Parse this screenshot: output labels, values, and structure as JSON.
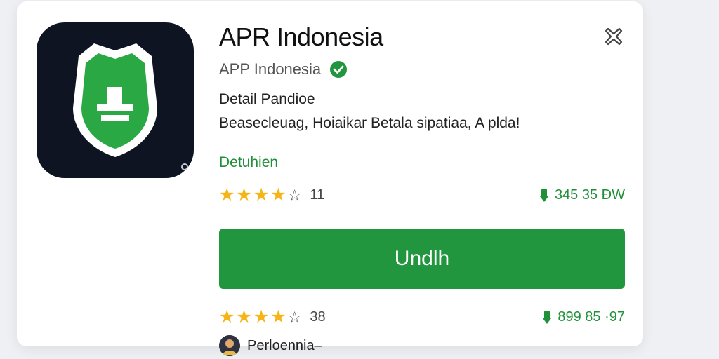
{
  "app": {
    "title": "APR Indonesia",
    "developer": "APP Indonesia",
    "detail_label": "Detail Pandioe",
    "description": "Beasecleuag, Hoiaikar Betala sipatiaa, A plda!",
    "category": "Detuhien"
  },
  "rating_primary": {
    "stars": 4,
    "count": "11",
    "downloads": "345 35 ĐW"
  },
  "install_button": {
    "label": "Undlh"
  },
  "rating_secondary": {
    "stars": 3.5,
    "count": "38",
    "downloads": "899 85 ·97"
  },
  "reviewer": {
    "name": "Perloennia–"
  },
  "icons": {
    "app_icon": "shield-icon",
    "close": "close-icon",
    "verified": "verified-check-icon",
    "download": "download-icon"
  },
  "colors": {
    "accent_green": "#22963f",
    "star_gold": "#f6b516",
    "app_icon_bg": "#0e1422"
  }
}
